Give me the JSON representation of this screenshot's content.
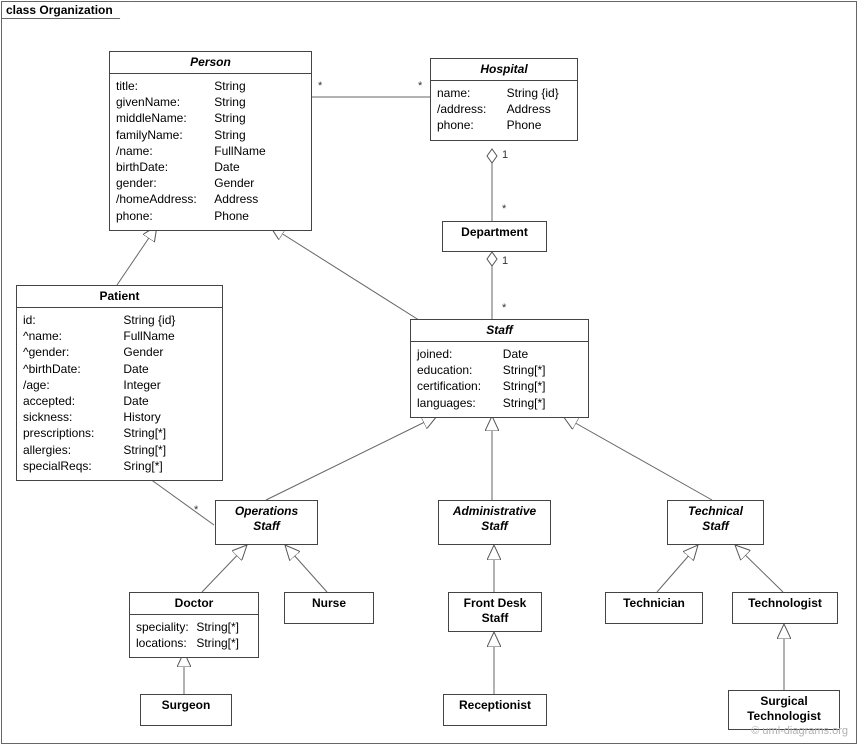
{
  "frame": {
    "label": "class Organization"
  },
  "watermark": "© uml-diagrams.org",
  "classes": {
    "person": {
      "name": "Person",
      "attrs": [
        {
          "k": "title:",
          "v": "String"
        },
        {
          "k": "givenName:",
          "v": "String"
        },
        {
          "k": "middleName:",
          "v": "String"
        },
        {
          "k": "familyName:",
          "v": "String"
        },
        {
          "k": "/name:",
          "v": "FullName"
        },
        {
          "k": "birthDate:",
          "v": "Date"
        },
        {
          "k": "gender:",
          "v": "Gender"
        },
        {
          "k": "/homeAddress:",
          "v": "Address"
        },
        {
          "k": "phone:",
          "v": "Phone"
        }
      ]
    },
    "hospital": {
      "name": "Hospital",
      "attrs": [
        {
          "k": "name:",
          "v": "String {id}"
        },
        {
          "k": "/address:",
          "v": "Address"
        },
        {
          "k": "phone:",
          "v": "Phone"
        }
      ]
    },
    "department": {
      "name": "Department"
    },
    "patient": {
      "name": "Patient",
      "attrs": [
        {
          "k": "id:",
          "v": "String {id}"
        },
        {
          "k": "^name:",
          "v": "FullName"
        },
        {
          "k": "^gender:",
          "v": "Gender"
        },
        {
          "k": "^birthDate:",
          "v": "Date"
        },
        {
          "k": "/age:",
          "v": "Integer"
        },
        {
          "k": "accepted:",
          "v": "Date"
        },
        {
          "k": "sickness:",
          "v": "History"
        },
        {
          "k": "prescriptions:",
          "v": "String[*]"
        },
        {
          "k": "allergies:",
          "v": "String[*]"
        },
        {
          "k": "specialReqs:",
          "v": "Sring[*]"
        }
      ]
    },
    "staff": {
      "name": "Staff",
      "attrs": [
        {
          "k": "joined:",
          "v": "Date"
        },
        {
          "k": "education:",
          "v": "String[*]"
        },
        {
          "k": "certification:",
          "v": "String[*]"
        },
        {
          "k": "languages:",
          "v": "String[*]"
        }
      ]
    },
    "opsStaff": {
      "name": "Operations\nStaff"
    },
    "adminStaff": {
      "name": "Administrative\nStaff"
    },
    "techStaff": {
      "name": "Technical\nStaff"
    },
    "doctor": {
      "name": "Doctor",
      "attrs": [
        {
          "k": "speciality:",
          "v": "String[*]"
        },
        {
          "k": "locations:",
          "v": "String[*]"
        }
      ]
    },
    "nurse": {
      "name": "Nurse"
    },
    "frontDesk": {
      "name": "Front Desk\nStaff"
    },
    "technician": {
      "name": "Technician"
    },
    "technologist": {
      "name": "Technologist"
    },
    "surgeon": {
      "name": "Surgeon"
    },
    "receptionist": {
      "name": "Receptionist"
    },
    "surgTech": {
      "name": "Surgical\nTechnologist"
    }
  },
  "multiplicities": {
    "person_hosp_left": "*",
    "person_hosp_right": "*",
    "hosp_dept_top": "1",
    "hosp_dept_bottom": "*",
    "dept_staff_top": "1",
    "dept_staff_bottom": "*",
    "patient_ops_top": "*",
    "patient_ops_bottom": "*"
  }
}
